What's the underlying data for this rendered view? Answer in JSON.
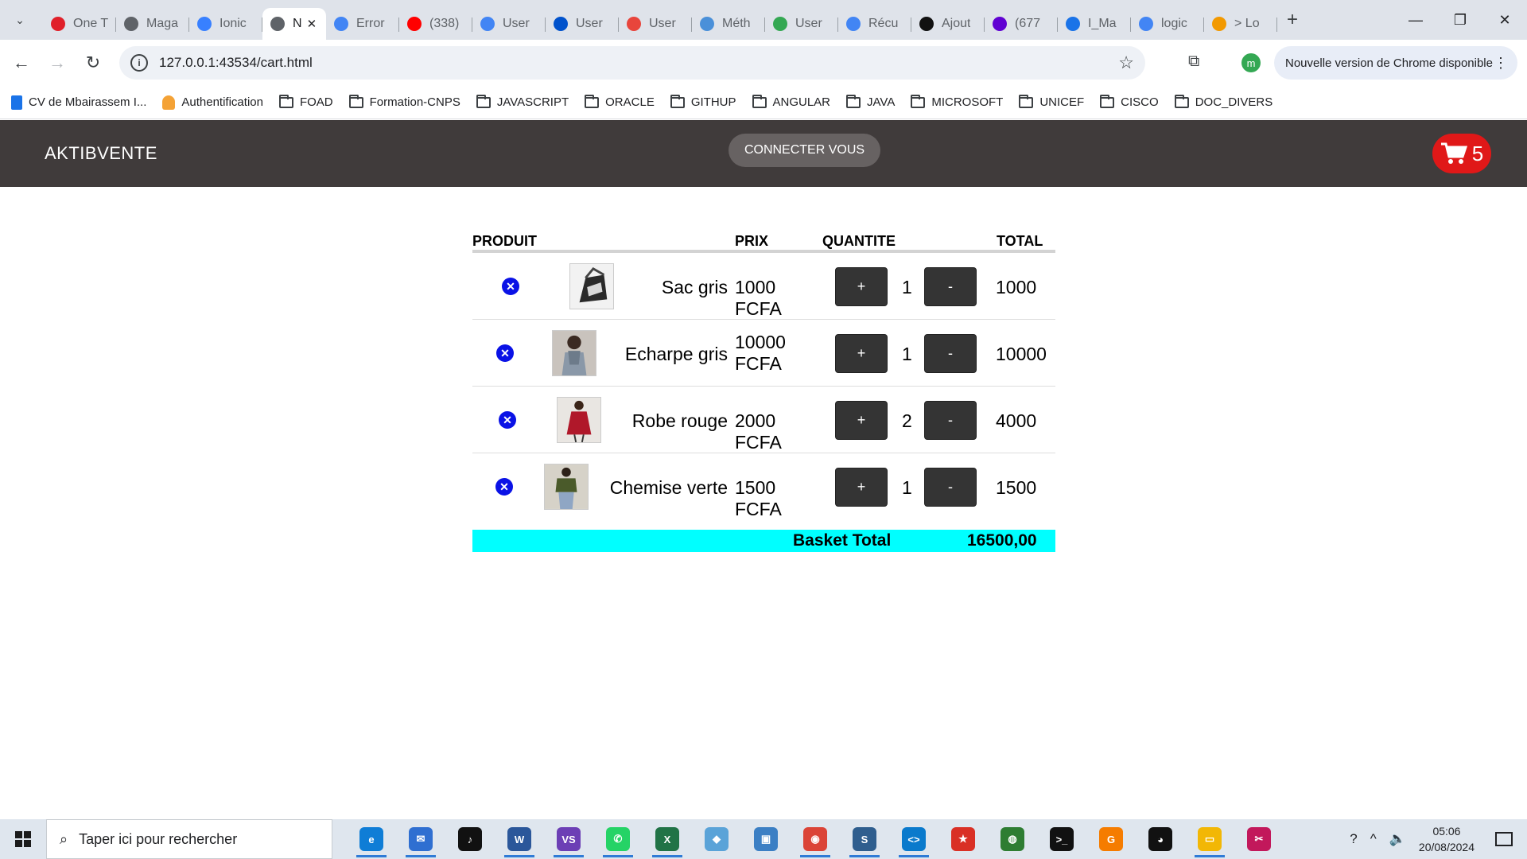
{
  "browser": {
    "tabs": [
      {
        "label": "One T",
        "icon": "opera-icon",
        "color": "#e0202a"
      },
      {
        "label": "Maga",
        "icon": "globe-icon",
        "color": "#5f6368"
      },
      {
        "label": "Ionic",
        "icon": "ionic-icon",
        "color": "#3880ff"
      },
      {
        "label": "N",
        "icon": "globe-icon",
        "color": "#5f6368",
        "active": true
      },
      {
        "label": "Error",
        "icon": "google-icon",
        "color": "#4285f4"
      },
      {
        "label": "(338)",
        "icon": "youtube-icon",
        "color": "#ff0000"
      },
      {
        "label": "User",
        "icon": "google-icon",
        "color": "#4285f4"
      },
      {
        "label": "User",
        "icon": "atlassian-icon",
        "color": "#0052cc"
      },
      {
        "label": "User",
        "icon": "cluster-icon",
        "color": "#e8453c"
      },
      {
        "label": "Méth",
        "icon": "ring-icon",
        "color": "#4a90d9"
      },
      {
        "label": "User",
        "icon": "leaf-icon",
        "color": "#34a853"
      },
      {
        "label": "Récu",
        "icon": "google-icon",
        "color": "#4285f4"
      },
      {
        "label": "Ajout",
        "icon": "u-icon",
        "color": "#111111"
      },
      {
        "label": "(677",
        "icon": "mail-icon",
        "color": "#6001d2"
      },
      {
        "label": "I_Ma",
        "icon": "doc-icon",
        "color": "#1a73e8"
      },
      {
        "label": "logic",
        "icon": "google-icon",
        "color": "#4285f4"
      },
      {
        "label": "> Lo",
        "icon": "sun-icon",
        "color": "#f29900"
      }
    ],
    "url": "127.0.0.1:43534/cart.html",
    "update_notice": "Nouvelle version de Chrome disponible",
    "profile_initial": "m",
    "bookmarks": [
      {
        "label": "CV de Mbairassem I...",
        "type": "doc"
      },
      {
        "label": "Authentification",
        "type": "auth"
      },
      {
        "label": "FOAD",
        "type": "folder"
      },
      {
        "label": "Formation-CNPS",
        "type": "folder"
      },
      {
        "label": "JAVASCRIPT",
        "type": "folder"
      },
      {
        "label": "ORACLE",
        "type": "folder"
      },
      {
        "label": "GITHUP",
        "type": "folder"
      },
      {
        "label": "ANGULAR",
        "type": "folder"
      },
      {
        "label": "JAVA",
        "type": "folder"
      },
      {
        "label": "MICROSOFT",
        "type": "folder"
      },
      {
        "label": "UNICEF",
        "type": "folder"
      },
      {
        "label": "CISCO",
        "type": "folder"
      },
      {
        "label": "DOC_DIVERS",
        "type": "folder"
      }
    ]
  },
  "app": {
    "brand": "AKTIBVENTE",
    "login_label": "CONNECTER VOUS",
    "cart_count": "5",
    "colors": {
      "header": "#403b3b",
      "cart_badge": "#e01818",
      "total_bar": "#00ffff",
      "remove": "#0a12e6"
    }
  },
  "cart": {
    "headers": {
      "product": "PRODUIT",
      "price": "PRIX",
      "quantity": "QUANTITE",
      "total": "TOTAL"
    },
    "plus_label": "+",
    "minus_label": "-",
    "remove_glyph": "✕",
    "items": [
      {
        "name": "Sac gris",
        "price": "1000 FCFA",
        "quantity": "1",
        "total": "1000"
      },
      {
        "name": "Echarpe gris",
        "price": "10000 FCFA",
        "quantity": "1",
        "total": "10000"
      },
      {
        "name": "Robe rouge",
        "price": "2000 FCFA",
        "quantity": "2",
        "total": "4000"
      },
      {
        "name": "Chemise verte",
        "price": "1500 FCFA",
        "quantity": "1",
        "total": "1500"
      }
    ],
    "basket_total_label": "Basket Total",
    "basket_total_value": "16500,00"
  },
  "taskbar": {
    "search_placeholder": "Taper ici pour rechercher",
    "apps": [
      {
        "name": "edge-icon",
        "color": "#0f7dd6",
        "glyph": "e"
      },
      {
        "name": "mail-icon",
        "color": "#2f6fd1",
        "glyph": "✉"
      },
      {
        "name": "tiktok-icon",
        "color": "#111111",
        "glyph": "♪"
      },
      {
        "name": "word-icon",
        "color": "#2b579a",
        "glyph": "W"
      },
      {
        "name": "visual-studio-icon",
        "color": "#6c3fb5",
        "glyph": "VS"
      },
      {
        "name": "whatsapp-icon",
        "color": "#25d366",
        "glyph": "✆"
      },
      {
        "name": "excel-icon",
        "color": "#217346",
        "glyph": "X"
      },
      {
        "name": "eraser-icon",
        "color": "#5aa3d8",
        "glyph": "◆"
      },
      {
        "name": "control-panel-icon",
        "color": "#3b7fc4",
        "glyph": "▣"
      },
      {
        "name": "chrome-icon",
        "color": "#db4437",
        "glyph": "◉"
      },
      {
        "name": "sql-developer-icon",
        "color": "#2f5e8e",
        "glyph": "S"
      },
      {
        "name": "vscode-icon",
        "color": "#0a7acc",
        "glyph": "<>"
      },
      {
        "name": "star-app-icon",
        "color": "#d93025",
        "glyph": "★"
      },
      {
        "name": "globe-app-icon",
        "color": "#2e7d32",
        "glyph": "◍"
      },
      {
        "name": "terminal-icon",
        "color": "#111111",
        "glyph": ">_"
      },
      {
        "name": "pdf-app-icon",
        "color": "#f57c00",
        "glyph": "G"
      },
      {
        "name": "github-icon",
        "color": "#111111",
        "glyph": "◕"
      },
      {
        "name": "file-explorer-icon",
        "color": "#f2b705",
        "glyph": "▭"
      },
      {
        "name": "snipping-tool-icon",
        "color": "#c2185b",
        "glyph": "✂"
      }
    ],
    "time": "05:06",
    "date": "20/08/2024"
  }
}
